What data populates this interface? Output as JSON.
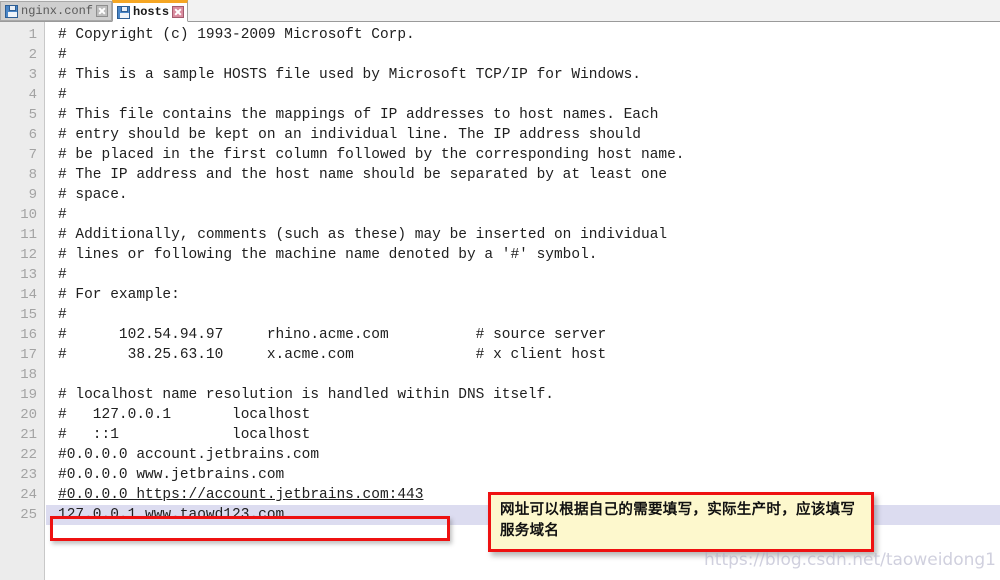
{
  "window": {
    "title": "hosts"
  },
  "tabs": [
    {
      "label": "nginx.conf",
      "active": false,
      "file_icon": "floppy-disk-icon",
      "close_icon": "close-icon"
    },
    {
      "label": "hosts",
      "active": true,
      "file_icon": "floppy-disk-icon",
      "close_icon": "close-icon"
    }
  ],
  "editor": {
    "line_numbers": [
      "1",
      "2",
      "3",
      "4",
      "5",
      "6",
      "7",
      "8",
      "9",
      "10",
      "11",
      "12",
      "13",
      "14",
      "15",
      "16",
      "17",
      "18",
      "19",
      "20",
      "21",
      "22",
      "23",
      "24",
      "25"
    ],
    "lines": [
      {
        "n": "1",
        "text": "# Copyright (c) 1993-2009 Microsoft Corp.",
        "style": "normal"
      },
      {
        "n": "2",
        "text": "#",
        "style": "normal"
      },
      {
        "n": "3",
        "text": "# This is a sample HOSTS file used by Microsoft TCP/IP for Windows.",
        "style": "normal"
      },
      {
        "n": "4",
        "text": "#",
        "style": "normal"
      },
      {
        "n": "5",
        "text": "# This file contains the mappings of IP addresses to host names. Each",
        "style": "normal"
      },
      {
        "n": "6",
        "text": "# entry should be kept on an individual line. The IP address should",
        "style": "normal"
      },
      {
        "n": "7",
        "text": "# be placed in the first column followed by the corresponding host name.",
        "style": "normal"
      },
      {
        "n": "8",
        "text": "# The IP address and the host name should be separated by at least one",
        "style": "normal"
      },
      {
        "n": "9",
        "text": "# space.",
        "style": "normal"
      },
      {
        "n": "10",
        "text": "#",
        "style": "normal"
      },
      {
        "n": "11",
        "text": "# Additionally, comments (such as these) may be inserted on individual",
        "style": "normal"
      },
      {
        "n": "12",
        "text": "# lines or following the machine name denoted by a '#' symbol.",
        "style": "normal"
      },
      {
        "n": "13",
        "text": "#",
        "style": "normal"
      },
      {
        "n": "14",
        "text": "# For example:",
        "style": "normal"
      },
      {
        "n": "15",
        "text": "#",
        "style": "normal"
      },
      {
        "n": "16",
        "text": "#      102.54.94.97     rhino.acme.com          # source server",
        "style": "normal"
      },
      {
        "n": "17",
        "text": "#       38.25.63.10     x.acme.com              # x client host",
        "style": "normal"
      },
      {
        "n": "18",
        "text": "",
        "style": "normal"
      },
      {
        "n": "19",
        "text": "# localhost name resolution is handled within DNS itself.",
        "style": "normal"
      },
      {
        "n": "20",
        "text": "#   127.0.0.1       localhost",
        "style": "normal"
      },
      {
        "n": "21",
        "text": "#   ::1             localhost",
        "style": "normal"
      },
      {
        "n": "22",
        "text": "#0.0.0.0 account.jetbrains.com",
        "style": "normal"
      },
      {
        "n": "23",
        "text": "#0.0.0.0 www.jetbrains.com",
        "style": "normal"
      },
      {
        "n": "24",
        "text": "#0.0.0.0 https://account.jetbrains.com:443",
        "style": "link"
      },
      {
        "n": "25",
        "text": "127.0.0.1 www.taowd123.com",
        "style": "selected"
      }
    ]
  },
  "annotations": {
    "callout_text": "网址可以根据自己的需要填写，实际生产时，应该填写服务域名",
    "callout_border_color": "#ee1111",
    "callout_fill_color": "#fdf8cd",
    "highlight_border_color": "#ee1111",
    "highlight_target_line": "25"
  },
  "watermark": {
    "text": "https://blog.csdn.net/taoweidong1"
  }
}
